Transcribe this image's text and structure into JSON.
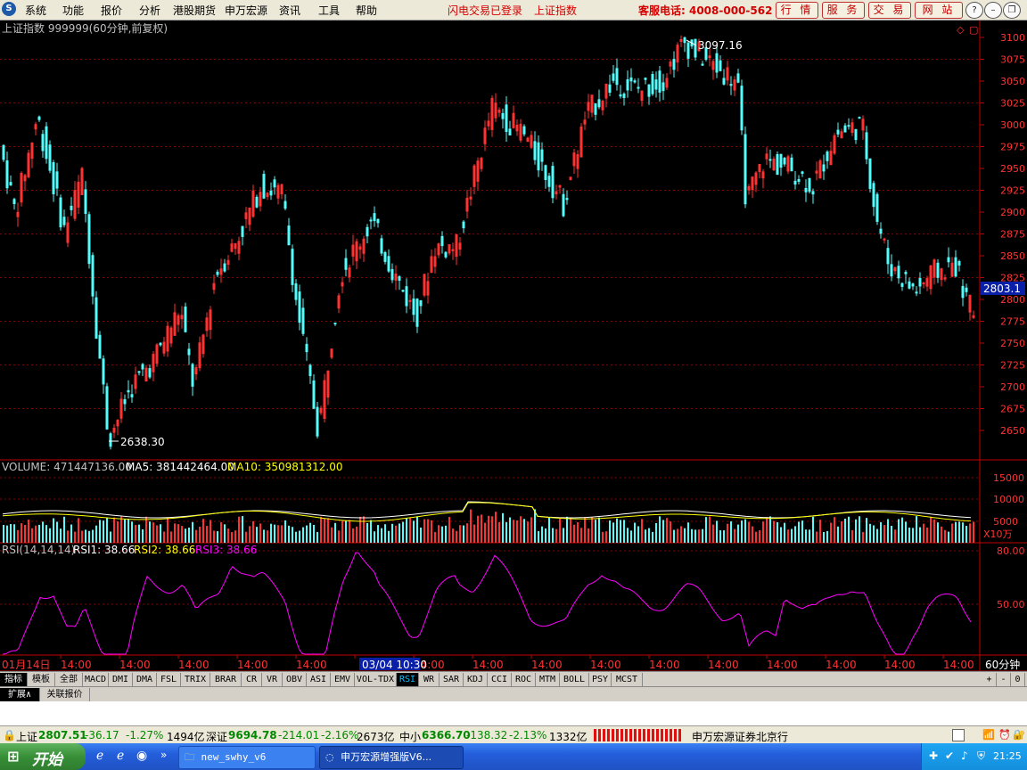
{
  "menu": {
    "items": [
      "系统",
      "功能",
      "报价",
      "分析",
      "港股期货",
      "申万宏源",
      "资讯",
      "工具",
      "帮助"
    ],
    "login_status": "闪电交易已登录",
    "index_link": "上证指数",
    "hotline": "客服电话: 4008-000-562",
    "buttons": [
      "行 情",
      "服 务",
      "交 易",
      "网 站"
    ]
  },
  "chart": {
    "title": "上证指数 999999(60分钟,前复权)",
    "max_label": "3097.16",
    "min_label": "2638.30",
    "current_price": "2803.1",
    "price_axis": [
      "3100",
      "3075",
      "3050",
      "3025",
      "3000",
      "2975",
      "2950",
      "2925",
      "2900",
      "2875",
      "2850",
      "2825",
      "2800",
      "2775",
      "2750",
      "2725",
      "2700",
      "2675",
      "2650"
    ],
    "volume": {
      "label": "VOLUME: 471447136.00",
      "ma5": "MA5: 381442464.00",
      "ma10": "MA10: 350981312.00",
      "axis": [
        "15000",
        "10000",
        "5000"
      ],
      "unit": "X10万"
    },
    "rsi": {
      "label": "RSI(14,14,14)",
      "rsi1": "RSI1: 38.66",
      "rsi2": "RSI2: 38.66",
      "rsi3": "RSI3: 38.66",
      "axis": [
        "80.00",
        "50.00"
      ]
    },
    "date_axis": {
      "first": "01月14日",
      "ticks": [
        "14:00",
        "14:00",
        "14:00",
        "14:00",
        "14:00",
        "14:00",
        "14:00",
        "14:00",
        "14:00",
        "14:00",
        "14:00",
        "14:00",
        "14:00",
        "14:00",
        "14:00",
        "14:00"
      ],
      "cursor": "03/04 10:30",
      "period": "60分钟"
    }
  },
  "indicator_tabs": [
    "指标",
    "模板",
    "全部",
    "MACD",
    "DMI",
    "DMA",
    "FSL",
    "TRIX",
    "BRAR",
    "CR",
    "VR",
    "OBV",
    "ASI",
    "EMV",
    "VOL-TDX",
    "RSI",
    "WR",
    "SAR",
    "KDJ",
    "CCI",
    "ROC",
    "MTM",
    "BOLL",
    "PSY",
    "MCST"
  ],
  "ext_tabs": [
    "扩展∧",
    "关联报价"
  ],
  "controls": [
    "+",
    "-",
    "0"
  ],
  "status": {
    "sh_name": "上证",
    "sh_value": "2807.51",
    "sh_change": "-36.17",
    "sh_pct": "-1.27%",
    "sh_amount": "1494亿",
    "sz_name": "深证",
    "sz_value": "9694.78",
    "sz_change": "-214.01",
    "sz_pct": "-2.16%",
    "sz_amount": "2673亿",
    "zx_name": "中小",
    "zx_value": "6366.70",
    "zx_change": "-138.32",
    "zx_pct": "-2.13%",
    "zx_amount": "1332亿",
    "broker": "申万宏源证券北京行"
  },
  "taskbar": {
    "start": "开始",
    "tasks": [
      "new_swhy_v6",
      "申万宏源增强版V6..."
    ],
    "clock": "21:25"
  },
  "colors": {
    "up": "#ff3232",
    "down": "#54fcfc",
    "ma5": "#ffffff",
    "ma10": "#ffff00",
    "rsi": "#ff00ff",
    "grid": "#8b0000",
    "axis_text": "#ff3232"
  }
}
